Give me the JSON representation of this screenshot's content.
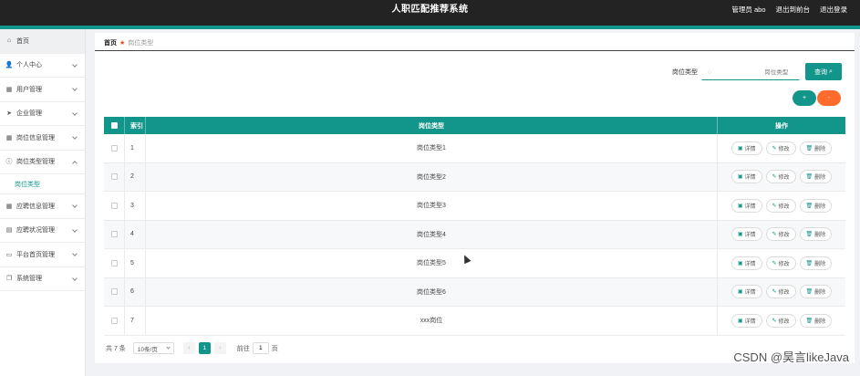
{
  "header": {
    "title": "人职匹配推荐系统",
    "user": "管理员 abo",
    "exit_dashboard": "退出到前台",
    "logout": "退出登录"
  },
  "sidebar": {
    "items": [
      {
        "label": "首页",
        "icon": "home-icon"
      },
      {
        "label": "个人中心",
        "icon": "user-icon"
      },
      {
        "label": "用户管理",
        "icon": "grid-icon"
      },
      {
        "label": "企业管理",
        "icon": "send-icon"
      },
      {
        "label": "岗位信息管理",
        "icon": "grid-icon"
      },
      {
        "label": "岗位类型管理",
        "icon": "info-icon"
      },
      {
        "label": "应聘信息管理",
        "icon": "grid-icon"
      },
      {
        "label": "应聘状况管理",
        "icon": "chat-icon"
      },
      {
        "label": "平台首页管理",
        "icon": "monitor-icon"
      },
      {
        "label": "系统管理",
        "icon": "copy-icon"
      }
    ],
    "submenu": {
      "label": "岗位类型"
    }
  },
  "breadcrumb": {
    "home": "首页",
    "current": "岗位类型"
  },
  "search": {
    "label": "岗位类型",
    "placeholder": "岗位类型",
    "button": "查询"
  },
  "actions": {
    "add": "+",
    "delete": "-"
  },
  "table": {
    "columns": {
      "index": "索引",
      "type": "岗位类型",
      "ops": "操作"
    },
    "op_labels": {
      "detail": "详情",
      "edit": "修改",
      "delete": "删除"
    },
    "rows": [
      {
        "index": "1",
        "type": "岗位类型1"
      },
      {
        "index": "2",
        "type": "岗位类型2"
      },
      {
        "index": "3",
        "type": "岗位类型3"
      },
      {
        "index": "4",
        "type": "岗位类型4"
      },
      {
        "index": "5",
        "type": "岗位类型5"
      },
      {
        "index": "6",
        "type": "岗位类型6"
      },
      {
        "index": "7",
        "type": "xxx岗位"
      }
    ]
  },
  "pager": {
    "total": "共 7 条",
    "page_size": "10条/页",
    "current_page": "1",
    "goto_label": "前往",
    "goto_value": "1",
    "goto_suffix": "页"
  },
  "watermark": "CSDN @昊言likeJava",
  "colors": {
    "accent": "#12958a",
    "danger": "#ff6b2c",
    "topbar": "#232323"
  }
}
